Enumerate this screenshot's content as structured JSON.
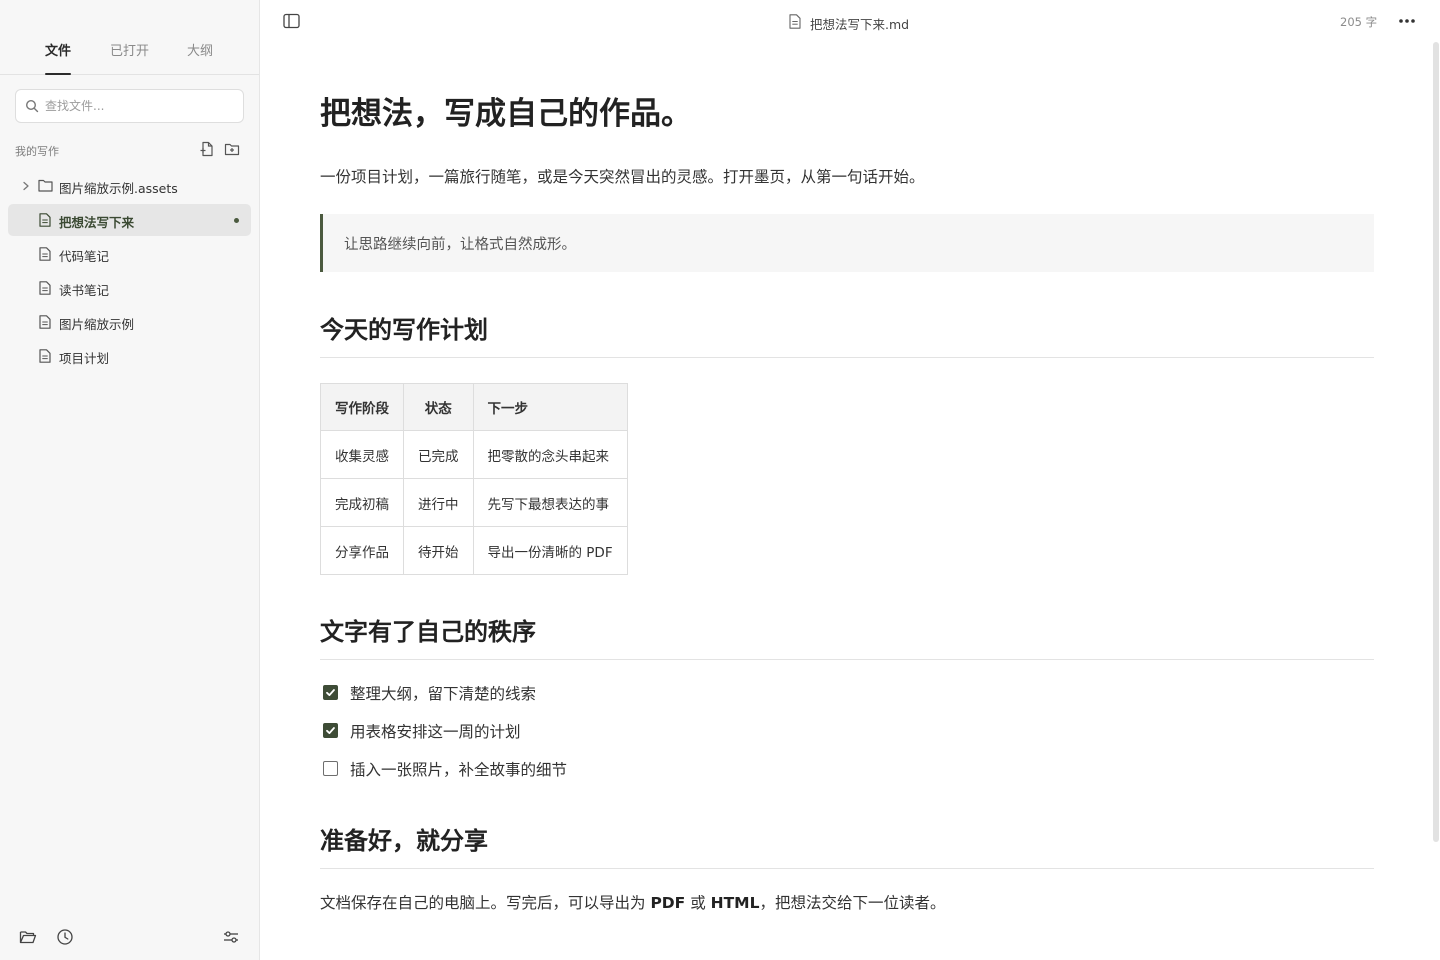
{
  "sidebar": {
    "tabs": [
      "文件",
      "已打开",
      "大纲"
    ],
    "search_placeholder": "查找文件...",
    "section_label": "我的写作",
    "items": [
      {
        "label": "图片缩放示例.assets",
        "type": "folder"
      },
      {
        "label": "把想法写下来",
        "type": "file",
        "active": true,
        "modified": true
      },
      {
        "label": "代码笔记",
        "type": "file"
      },
      {
        "label": "读书笔记",
        "type": "file"
      },
      {
        "label": "图片缩放示例",
        "type": "file"
      },
      {
        "label": "项目计划",
        "type": "file"
      }
    ]
  },
  "toolbar": {
    "doc_title": "把想法写下来.md",
    "word_count": "205 字"
  },
  "document": {
    "title": "把想法，写成自己的作品。",
    "intro": "一份项目计划，一篇旅行随笔，或是今天突然冒出的灵感。打开墨页，从第一句话开始。",
    "quote": "让思路继续向前，让格式自然成形。",
    "section1": {
      "heading": "今天的写作计划",
      "table": {
        "headers": [
          "写作阶段",
          "状态",
          "下一步"
        ],
        "rows": [
          [
            "收集灵感",
            "已完成",
            "把零散的念头串起来"
          ],
          [
            "完成初稿",
            "进行中",
            "先写下最想表达的事"
          ],
          [
            "分享作品",
            "待开始",
            "导出一份清晰的 PDF"
          ]
        ]
      }
    },
    "section2": {
      "heading": "文字有了自己的秩序",
      "tasks": [
        {
          "text": "整理大纲，留下清楚的线索",
          "checked": true
        },
        {
          "text": "用表格安排这一周的计划",
          "checked": true
        },
        {
          "text": "插入一张照片，补全故事的细节",
          "checked": false
        }
      ]
    },
    "section3": {
      "heading": "准备好，就分享",
      "para_before": "文档保存在自己的电脑上。写完后，可以导出为 ",
      "pdf": "PDF",
      "or": " 或 ",
      "html": "HTML",
      "para_after": "，把想法交给下一位读者。"
    }
  },
  "colors": {
    "accent": "#3e4c36",
    "sidebar_bg": "#f7f7f7",
    "active_item_bg": "#e6e6e6"
  },
  "icons": {
    "sidebar_toggle": "sidebar-toggle-icon",
    "more": "more-horizontal-icon",
    "new_file": "new-file-icon",
    "new_folder": "new-folder-icon",
    "open_folder": "open-folder-icon",
    "history": "history-icon",
    "settings": "sliders-icon"
  }
}
